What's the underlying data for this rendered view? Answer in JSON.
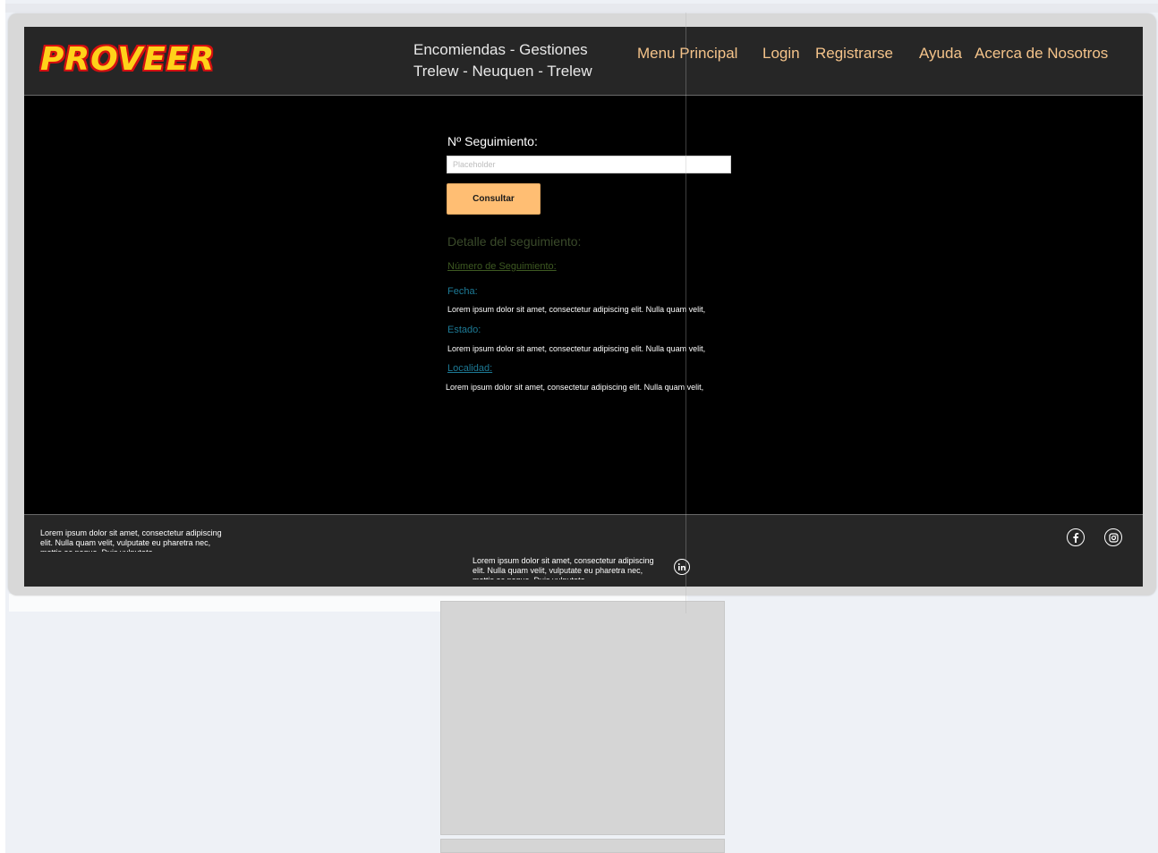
{
  "brand": {
    "logo_text": "PROVEER"
  },
  "header": {
    "tagline_line1": "Encomiendas - Gestiones",
    "tagline_line2": "Trelew - Neuquen - Trelew"
  },
  "nav": {
    "menu_principal": "Menu Principal",
    "login": "Login",
    "registrarse": "Registrarse",
    "ayuda": "Ayuda",
    "acerca": "Acerca de Nosotros"
  },
  "tracking": {
    "label": "Nº Seguimiento:",
    "input_value": "",
    "input_placeholder": "Placeholder",
    "button_label": "Consultar"
  },
  "detail": {
    "title": "Detalle del seguimiento:",
    "number_label": "Número de Seguimiento:",
    "fecha_label": "Fecha:",
    "fecha_text": "Lorem ipsum dolor sit amet, consectetur adipiscing elit. Nulla quam velit, vulputate eu pharetra nec, mattis ac neque.",
    "estado_label": "Estado:",
    "estado_text": "Lorem ipsum dolor sit amet, consectetur adipiscing elit. Nulla quam velit, vulputate eu pharetra nec, mattis ac neque.",
    "localidad_label": "Localidad:",
    "localidad_text": "Lorem ipsum dolor sit amet, consectetur adipiscing elit. Nulla quam velit, vulputate eu pharetra nec, mattis ac neque."
  },
  "footer": {
    "left_text": "Lorem ipsum dolor sit amet, consectetur adipiscing elit. Nulla quam velit, vulputate eu pharetra nec, mattis ac neque. Duis vulputate.",
    "center_text": "Lorem ipsum dolor sit amet, consectetur adipiscing elit. Nulla quam velit, vulputate eu pharetra nec, mattis ac neque. Duis vulputate.",
    "icons": {
      "facebook": "facebook-icon",
      "instagram": "instagram-icon",
      "linkedin": "linkedin-icon"
    }
  },
  "colors": {
    "screen_bg": "#000000",
    "bar_bg": "#262626",
    "nav_accent": "#f4c38a",
    "button_bg": "#ffbe73",
    "logo_fill": "#ffd21a",
    "logo_outline": "#d41010",
    "label_teal": "#1d7a96"
  }
}
